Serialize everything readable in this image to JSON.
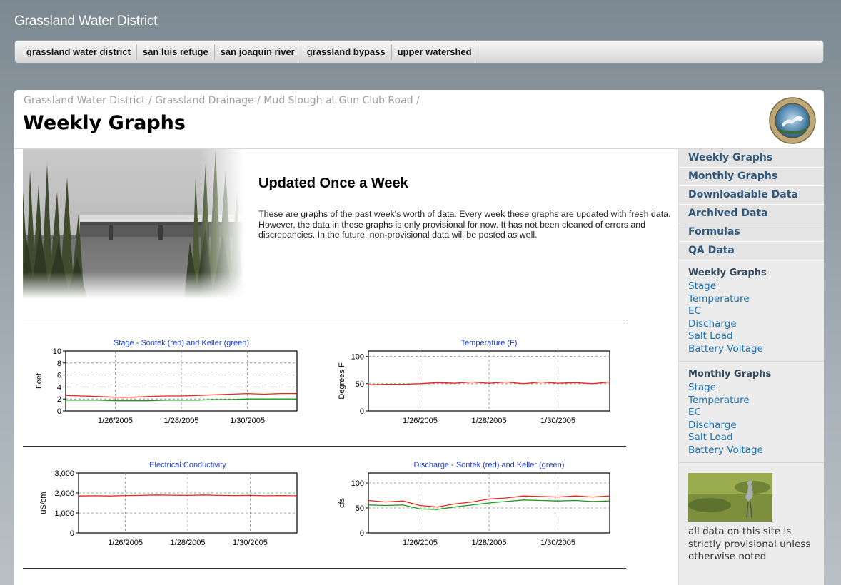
{
  "site": {
    "title": "Grassland Water District"
  },
  "topnav": [
    {
      "label": "grassland water district"
    },
    {
      "label": "san luis refuge"
    },
    {
      "label": "san joaquin river"
    },
    {
      "label": "grassland bypass"
    },
    {
      "label": "upper watershed"
    }
  ],
  "breadcrumb": {
    "items": [
      "Grassland Water District",
      "Grassland Drainage",
      "Mud Slough at Gun Club Road"
    ],
    "separator": " / "
  },
  "page": {
    "title": "Weekly Graphs"
  },
  "intro": {
    "title": "Updated Once a Week",
    "text": "These are graphs of the past week's worth of data. Every week these graphs are updated with fresh data. However, the data in these graphs is only provisional for now. It has not been cleaned of errors and discrepancies. In the future, non-provisional data will be posted as well."
  },
  "sidebar": {
    "nav": [
      {
        "label": "Weekly Graphs"
      },
      {
        "label": "Monthly Graphs"
      },
      {
        "label": "Downloadable Data"
      },
      {
        "label": "Archived Data"
      },
      {
        "label": "Formulas"
      },
      {
        "label": "QA Data"
      }
    ],
    "weekly": {
      "heading": "Weekly Graphs",
      "links": [
        "Stage",
        "Temperature",
        "EC",
        "Discharge",
        "Salt Load",
        "Battery Voltage"
      ]
    },
    "monthly": {
      "heading": "Monthly Graphs",
      "links": [
        "Stage",
        "Temperature",
        "EC",
        "Discharge",
        "Salt Load",
        "Battery Voltage"
      ]
    },
    "note": "all data on this site is strictly provisional unless otherwise noted"
  },
  "colors": {
    "series_red": "#e8281e",
    "series_green": "#1c9a1c",
    "chart_title": "#1a3dcc",
    "sidebar_link": "#1a6fb0"
  },
  "chart_data": [
    {
      "type": "line",
      "title": "Stage - Sontek (red) and Keller (green)",
      "ylabel": "Feet",
      "ylim": [
        0,
        10
      ],
      "yticks": [
        0,
        2,
        4,
        6,
        8,
        10
      ],
      "xlim": [
        0,
        7
      ],
      "xticks": [
        {
          "value": 1.5,
          "label": "1/26/2005"
        },
        {
          "value": 3.5,
          "label": "1/28/2005"
        },
        {
          "value": 5.5,
          "label": "1/30/2005"
        }
      ],
      "series": [
        {
          "color": "#e8281e",
          "x": [
            0,
            0.5,
            1,
            1.5,
            2,
            2.5,
            3,
            3.5,
            4,
            4.5,
            5,
            5.5,
            6,
            6.5,
            7
          ],
          "values": [
            2.6,
            2.5,
            2.4,
            2.3,
            2.3,
            2.4,
            2.5,
            2.5,
            2.6,
            2.7,
            2.8,
            2.9,
            2.8,
            2.9,
            2.9
          ]
        },
        {
          "color": "#1c9a1c",
          "x": [
            0,
            0.5,
            1,
            1.5,
            2,
            2.5,
            3,
            3.5,
            4,
            4.5,
            5,
            5.5,
            6,
            6.5,
            7
          ],
          "values": [
            1.8,
            1.8,
            1.8,
            1.7,
            1.7,
            1.7,
            1.8,
            1.8,
            1.8,
            1.9,
            1.9,
            2.0,
            2.0,
            2.0,
            2.0
          ]
        }
      ]
    },
    {
      "type": "line",
      "title": "Temperature (F)",
      "ylabel": "Degrees F",
      "ylim": [
        0,
        110
      ],
      "yticks": [
        0,
        50,
        100
      ],
      "xlim": [
        0,
        7
      ],
      "xticks": [
        {
          "value": 1.5,
          "label": "1/26/2005"
        },
        {
          "value": 3.5,
          "label": "1/28/2005"
        },
        {
          "value": 5.5,
          "label": "1/30/2005"
        }
      ],
      "series": [
        {
          "color": "#e8281e",
          "x": [
            0,
            0.5,
            1,
            1.5,
            2,
            2.5,
            3,
            3.5,
            4,
            4.5,
            5,
            5.5,
            6,
            6.5,
            7
          ],
          "values": [
            48,
            49,
            49,
            50,
            52,
            51,
            53,
            51,
            53,
            50,
            53,
            51,
            52,
            50,
            53
          ]
        }
      ]
    },
    {
      "type": "line",
      "title": "Electrical Conductivity",
      "ylabel": "uS/cm",
      "ylim": [
        0,
        3000
      ],
      "yticks": [
        {
          "value": 0,
          "label": "0"
        },
        {
          "value": 1000,
          "label": "1,000"
        },
        {
          "value": 2000,
          "label": "2,000"
        },
        {
          "value": 3000,
          "label": "3,000"
        }
      ],
      "xlim": [
        0,
        7
      ],
      "xticks": [
        {
          "value": 1.5,
          "label": "1/26/2005"
        },
        {
          "value": 3.5,
          "label": "1/28/2005"
        },
        {
          "value": 5.5,
          "label": "1/30/2005"
        }
      ],
      "series": [
        {
          "color": "#e8281e",
          "x": [
            0,
            0.5,
            1,
            1.5,
            2,
            2.5,
            3,
            3.5,
            4,
            4.5,
            5,
            5.5,
            6,
            6.5,
            7
          ],
          "values": [
            1850,
            1860,
            1850,
            1870,
            1880,
            1900,
            1890,
            1880,
            1900,
            1880,
            1870,
            1880,
            1860,
            1870,
            1860
          ]
        }
      ]
    },
    {
      "type": "line",
      "title": "Discharge - Sontek (red) and Keller (green)",
      "ylabel": "cfs",
      "ylim": [
        0,
        120
      ],
      "yticks": [
        0,
        50,
        100
      ],
      "xlim": [
        0,
        7
      ],
      "xticks": [
        {
          "value": 1.5,
          "label": "1/26/2005"
        },
        {
          "value": 3.5,
          "label": "1/28/2005"
        },
        {
          "value": 5.5,
          "label": "1/30/2005"
        }
      ],
      "series": [
        {
          "color": "#e8281e",
          "x": [
            0,
            0.5,
            1,
            1.5,
            2,
            2.5,
            3,
            3.5,
            4,
            4.5,
            5,
            5.5,
            6,
            6.5,
            7
          ],
          "values": [
            65,
            62,
            64,
            55,
            52,
            58,
            62,
            68,
            70,
            74,
            73,
            72,
            74,
            72,
            74
          ]
        },
        {
          "color": "#1c9a1c",
          "x": [
            0,
            0.5,
            1,
            1.5,
            2,
            2.5,
            3,
            3.5,
            4,
            4.5,
            5,
            5.5,
            6,
            6.5,
            7
          ],
          "values": [
            56,
            55,
            56,
            48,
            47,
            52,
            56,
            60,
            63,
            66,
            65,
            64,
            65,
            63,
            64
          ]
        }
      ]
    }
  ]
}
